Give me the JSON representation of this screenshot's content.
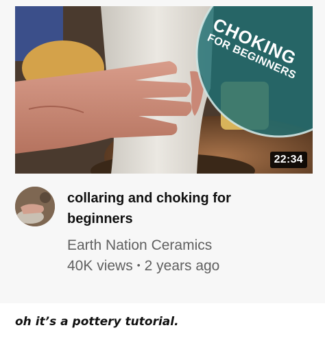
{
  "video": {
    "thumbnail_overlay": {
      "line1": "CHOKING",
      "line2": "FOR BEGINNERS"
    },
    "duration": "22:34",
    "title": "collaring and choking for beginners",
    "channel": "Earth Nation Ceramics",
    "views": "40K views",
    "separator": "•",
    "age": "2 years ago"
  },
  "caption": "oh it’s a pottery tutorial.",
  "colors": {
    "badge_teal": "#1f6f73",
    "badge_ring": "#cfe6e4",
    "meta_text": "#606060",
    "title_text": "#0f0f0f"
  }
}
